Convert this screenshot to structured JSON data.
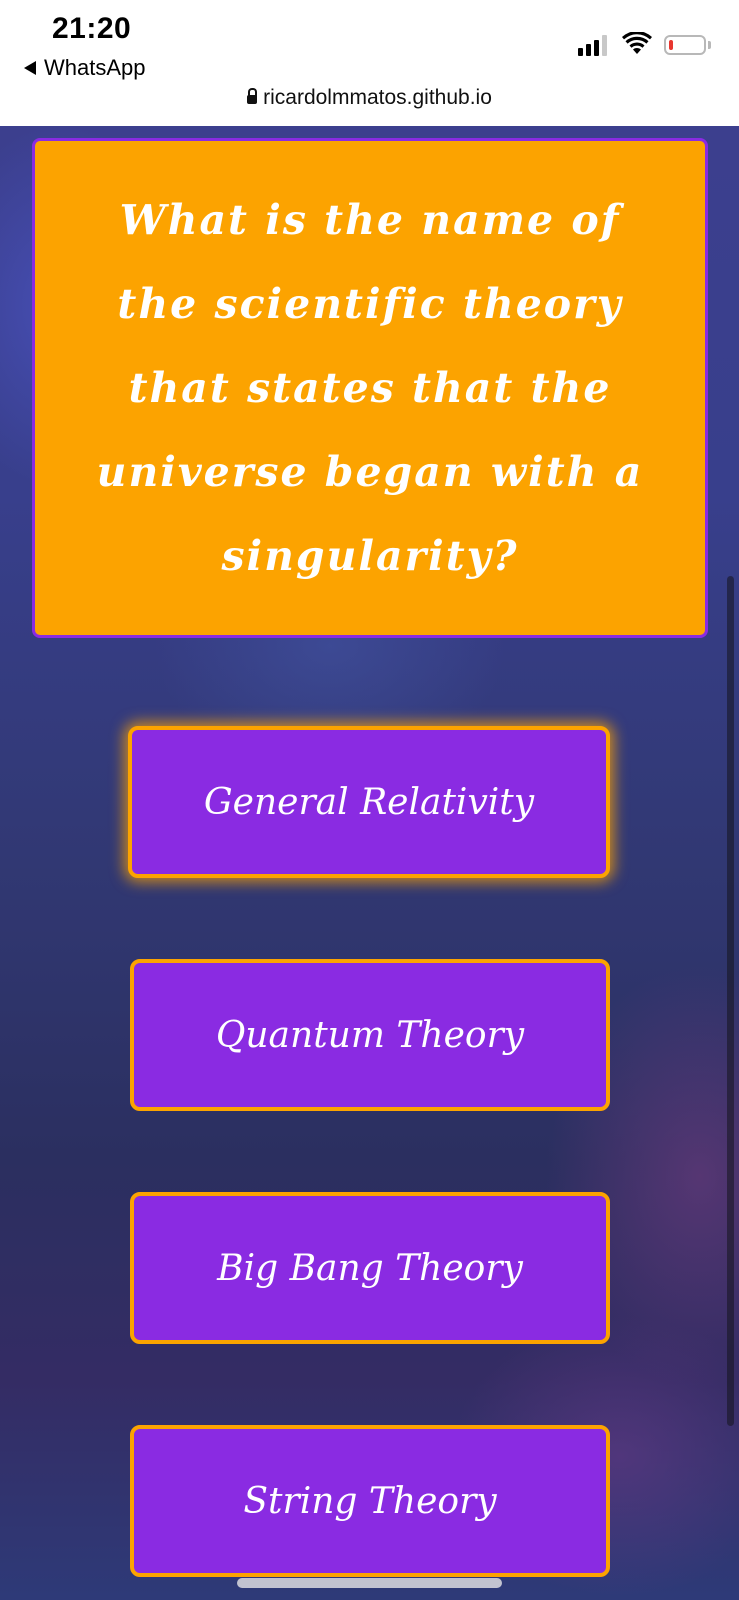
{
  "status_bar": {
    "time": "21:20",
    "back_app": "WhatsApp",
    "url": "ricardolmmatos.github.io",
    "battery_level": 0.1
  },
  "quiz": {
    "question": "What is the name of the scientific theory that states that the universe began with a singularity?",
    "answers": [
      "General Relativity",
      "Quantum Theory",
      "Big Bang Theory",
      "String Theory"
    ]
  },
  "colors": {
    "question_bg": "#fca300",
    "answer_bg": "#8a2be2",
    "answer_border": "#fca300",
    "text": "#ffffff"
  }
}
